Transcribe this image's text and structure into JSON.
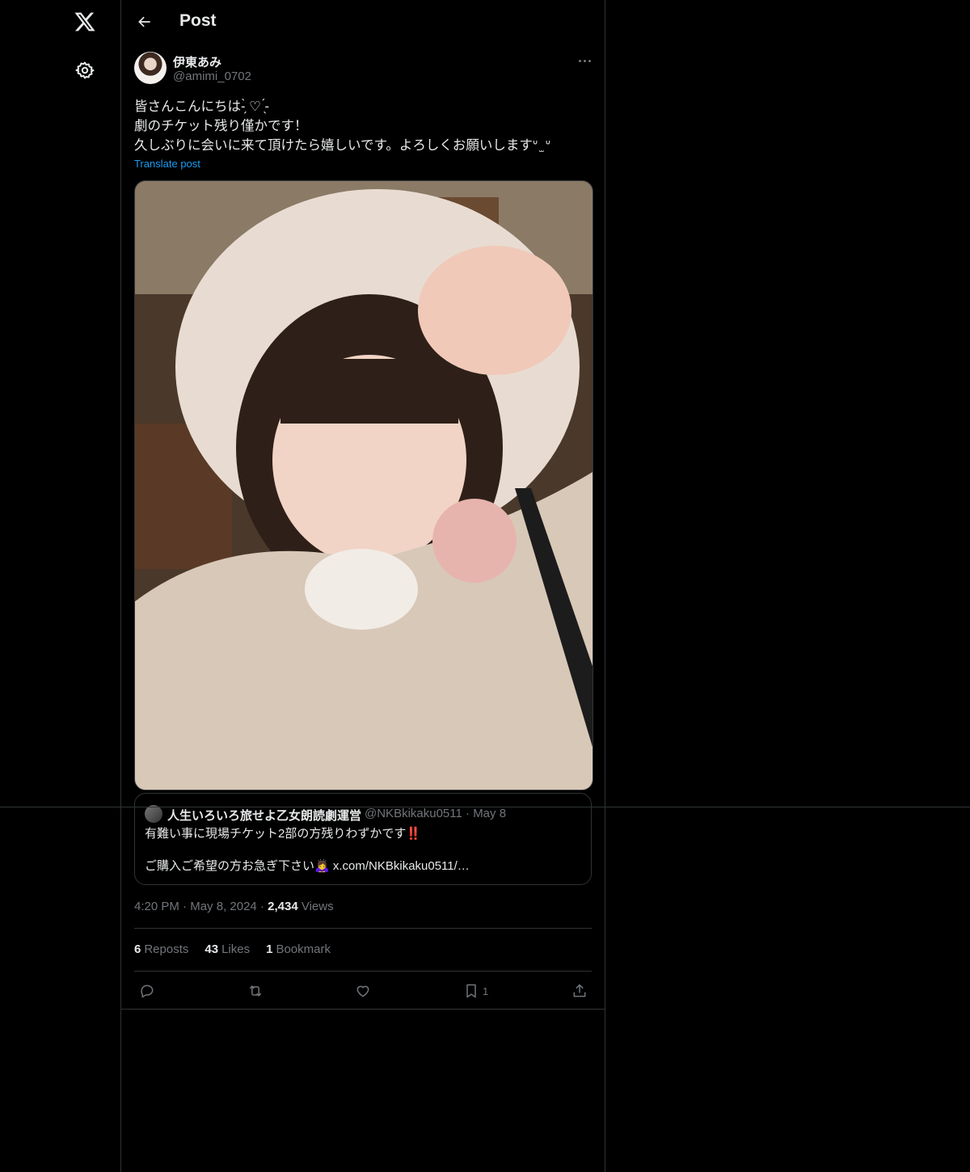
{
  "header": {
    "title": "Post"
  },
  "post": {
    "display_name": "伊東あみ",
    "handle": "@amimi_0702",
    "text": "皆さんこんにちは-̗̀ ♡ ̖́-\n劇のチケット残り僅かです！\n久しぶりに会いに来て頂けたら嬉しいです。よろしくお願いしますᐡ ̫ ᐡ",
    "translate_label": "Translate post"
  },
  "quote": {
    "name": "人生いろいろ旅せよ乙女朗読劇運営",
    "handle": "@NKBkikaku0511",
    "date": "May 8",
    "line1": "有難い事に現場チケット2部の方残りわずかです",
    "line1_emoji": "‼️",
    "line2": "ご購入ご希望の方お急ぎ下さい🙇‍♀️ x.com/NKBkikaku0511/…"
  },
  "meta": {
    "time": "4:20 PM",
    "date": "May 8, 2024",
    "views_count": "2,434",
    "views_label": "Views"
  },
  "stats": {
    "reposts_count": "6",
    "reposts_label": "Reposts",
    "likes_count": "43",
    "likes_label": "Likes",
    "bookmarks_count": "1",
    "bookmarks_label": "Bookmark"
  },
  "actions": {
    "bookmark_count": "1"
  },
  "icons": {
    "logo": "x-logo-icon",
    "settings": "gear-icon",
    "back": "arrow-left-icon",
    "more": "more-horizontal-icon",
    "reply": "reply-icon",
    "repost": "repost-icon",
    "like": "heart-icon",
    "bookmark": "bookmark-icon",
    "share": "share-icon"
  },
  "colors": {
    "background": "#000000",
    "text": "#e7e9ea",
    "muted": "#71767b",
    "accent": "#1d9bf0",
    "border": "#2f3336"
  }
}
